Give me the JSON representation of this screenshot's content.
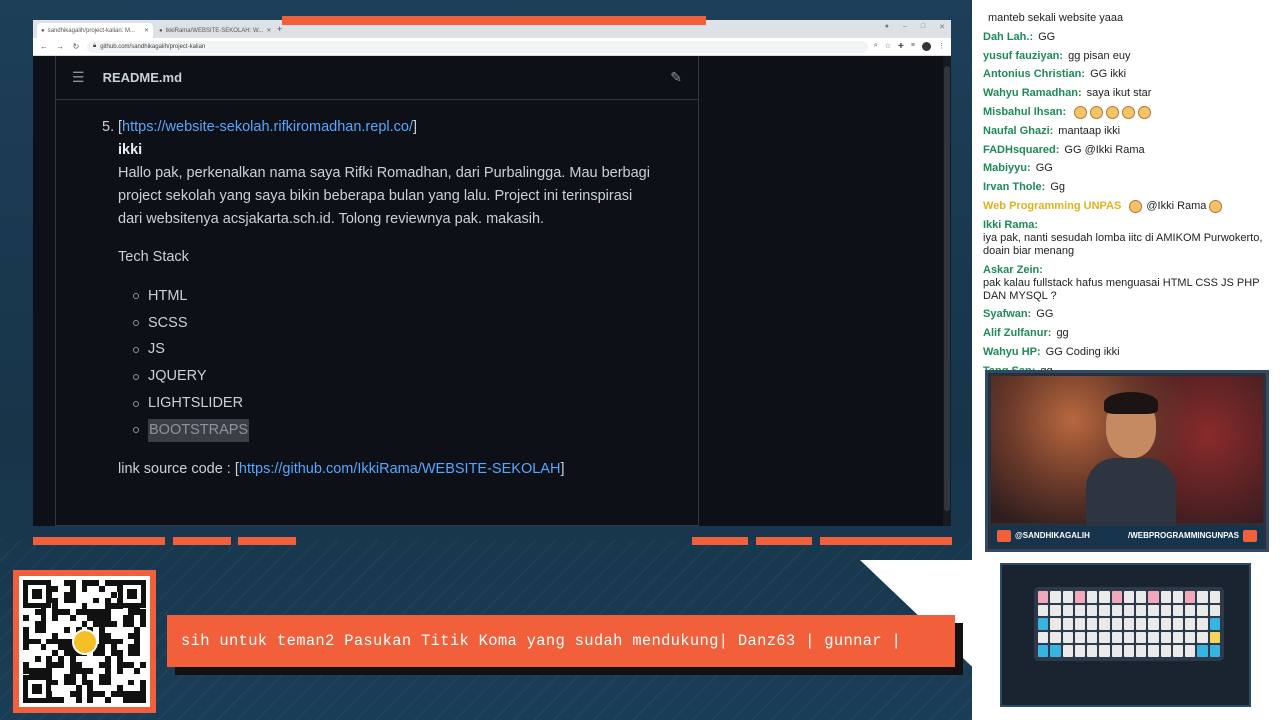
{
  "browser": {
    "tabs": [
      {
        "label": "sandhikagalih/project-kalian: M...",
        "active": true
      },
      {
        "label": "IkkiRama/WEBSITE-SEKOLAH: W...",
        "active": false
      }
    ],
    "url": "github.com/sandhikagalih/project-kalian"
  },
  "readme": {
    "filename": "README.md",
    "item_number": "5.",
    "item_link": "https://website-sekolah.rifkiromadhan.repl.co/",
    "author": "ikki",
    "paragraph": "Hallo pak, perkenalkan nama saya Rifki Romadhan, dari Purbalingga. Mau berbagi project sekolah yang saya bikin beberapa bulan yang lalu. Project ini terinspirasi dari websitenya acsjakarta.sch.id. Tolong reviewnya pak. makasih.",
    "tech_stack_label": "Tech Stack",
    "tech_stack": [
      "HTML",
      "SCSS",
      "JS",
      "JQUERY",
      "LIGHTSLIDER",
      "BOOTSTRAPS"
    ],
    "source_prefix": "link source code : [",
    "source_link": "https://github.com/IkkiRama/WEBSITE-SEKOLAH",
    "source_suffix": "]"
  },
  "chat": [
    {
      "user": "",
      "text": "manteb sekali website yaaa"
    },
    {
      "user": "Dah Lah.:",
      "text": "GG"
    },
    {
      "user": "yusuf fauziyan:",
      "text": "gg pisan euy"
    },
    {
      "user": "Antonius Christian:",
      "text": "GG ikki"
    },
    {
      "user": "Wahyu Ramadhan:",
      "text": "saya ikut star"
    },
    {
      "user": "Misbahul Ihsan:",
      "text": ""
    },
    {
      "user": "Naufal Ghazi:",
      "text": "mantaap ikki"
    },
    {
      "user": "FADHsquared:",
      "text": "GG @Ikki Rama"
    },
    {
      "user": "Mabiyyu:",
      "text": "GG"
    },
    {
      "user": "Irvan Thole:",
      "text": "Gg"
    },
    {
      "user": "Web Programming UNPAS",
      "text": "@Ikki Rama",
      "gold": true
    },
    {
      "user": "Ikki Rama:",
      "text": "iya pak, nanti sesudah lomba iitc di AMIKOM Purwokerto, doain biar menang"
    },
    {
      "user": "Askar Zein:",
      "text": "pak kalau fullstack hafus menguasai HTML CSS JS PHP DAN MYSQL ?"
    },
    {
      "user": "Syafwan:",
      "text": "GG"
    },
    {
      "user": "Alif Zulfanur:",
      "text": "gg"
    },
    {
      "user": "Wahyu HP:",
      "text": "GG Coding ikki"
    },
    {
      "user": "Tang San:",
      "text": "gg"
    }
  ],
  "webcam": {
    "handle_left": "@SANDHIKAGALIH",
    "handle_right": "/WEBPROGRAMMINGUNPAS"
  },
  "ticker": {
    "text": "sih untuk teman2 Pasukan Titik Koma yang sudah mendukung| Danz63 | gunnar |"
  },
  "colors": {
    "accent": "#f2603b",
    "chat_user": "#1f8a57",
    "link": "#58a6ff",
    "github_bg": "#0d1117"
  }
}
